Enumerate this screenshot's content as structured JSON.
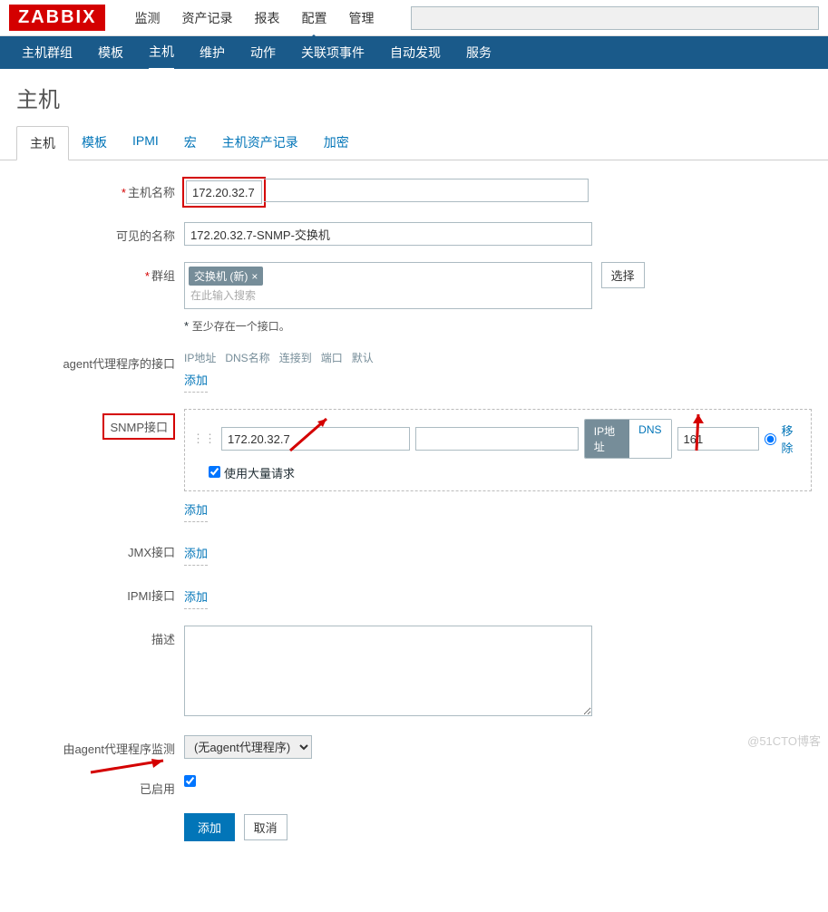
{
  "logo": "ZABBIX",
  "topnav": {
    "monitor": "监测",
    "inventory": "资产记录",
    "reports": "报表",
    "config": "配置",
    "admin": "管理"
  },
  "subnav": {
    "hostgroups": "主机群组",
    "templates": "模板",
    "hosts": "主机",
    "maintenance": "维护",
    "actions": "动作",
    "correlation": "关联项事件",
    "discovery": "自动发现",
    "services": "服务"
  },
  "page_title": "主机",
  "tabs": {
    "host": "主机",
    "templates": "模板",
    "ipmi": "IPMI",
    "macros": "宏",
    "inventory": "主机资产记录",
    "encryption": "加密"
  },
  "labels": {
    "hostname": "主机名称",
    "visible_name": "可见的名称",
    "groups": "群组",
    "group_search_ph": "在此输入搜索",
    "select_btn": "选择",
    "iface_hint": "至少存在一个接口。",
    "agent_iface": "agent代理程序的接口",
    "snmp_iface": "SNMP接口",
    "jmx_iface": "JMX接口",
    "ipmi_iface": "IPMI接口",
    "description": "描述",
    "proxy": "由agent代理程序监测",
    "enabled": "已启用",
    "add_link": "添加",
    "remove_link": "移除",
    "bulk_req": "使用大量请求",
    "iface_cols": {
      "ip": "IP地址",
      "dns": "DNS名称",
      "connect": "连接到",
      "port": "端口",
      "default": "默认"
    },
    "toggle_ip": "IP地址",
    "toggle_dns": "DNS",
    "btn_add": "添加",
    "btn_cancel": "取消"
  },
  "values": {
    "hostname": "172.20.32.7",
    "visible_name": "172.20.32.7-SNMP-交换机",
    "group_tag": "交换机 (新)",
    "snmp_ip": "172.20.32.7",
    "snmp_dns": "",
    "snmp_port": "161",
    "proxy_select": "(无agent代理程序)"
  },
  "watermark": "@51CTO博客"
}
